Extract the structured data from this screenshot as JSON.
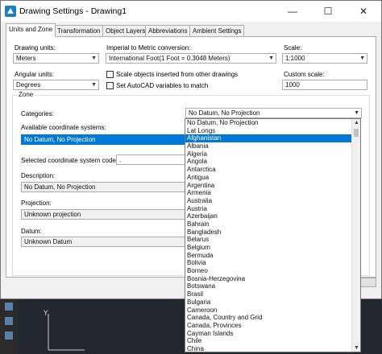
{
  "window": {
    "title": "Drawing Settings - Drawing1",
    "minimize": "—",
    "maximize": "☐",
    "close": "✕"
  },
  "tabs": [
    "Units and Zone",
    "Transformation",
    "Object Layers",
    "Abbreviations",
    "Ambient Settings"
  ],
  "units": {
    "drawing_units_label": "Drawing units:",
    "drawing_units_value": "Meters",
    "imperial_label": "Imperial to Metric conversion:",
    "imperial_value": "International Foot(1 Foot = 0.3048 Meters)",
    "scale_label": "Scale:",
    "scale_value": "1:1000",
    "angular_label": "Angular units:",
    "angular_value": "Degrees",
    "scale_objects_label": "Scale objects inserted from other drawings",
    "set_autocad_label": "Set AutoCAD variables to match",
    "custom_scale_label": "Custom scale:",
    "custom_scale_value": "1000"
  },
  "zone": {
    "title": "Zone",
    "categories_label": "Categories:",
    "categories_value": "No Datum, No Projection",
    "available_label": "Available coordinate systems:",
    "available_value": "No Datum, No Projection",
    "selected_code_label": "Selected coordinate system code:",
    "selected_code_value": ".",
    "description_label": "Description:",
    "description_value": "No Datum, No Projection",
    "projection_label": "Projection:",
    "projection_value": "Unknown projection",
    "datum_label": "Datum:",
    "datum_value": "Unknown Datum"
  },
  "dropdown": {
    "items": [
      "No Datum, No Projection",
      "Lat Longs",
      "Afghanistan",
      "Albania",
      "Algeria",
      "Angola",
      "Antarctica",
      "Antigua",
      "Argentina",
      "Armenia",
      "Australia",
      "Austria",
      "Azerbaijan",
      "Bahrain",
      "Bangladesh",
      "Belarus",
      "Belgium",
      "Bermuda",
      "Bolivia",
      "Borneo",
      "Bosnia-Herzegovina",
      "Botswana",
      "Brasil",
      "Bulgaria",
      "Cameroon",
      "Canada, Country and Grid",
      "Canada, Provinces",
      "Cayman Islands",
      "Chile",
      "China"
    ],
    "highlighted_index": 2
  },
  "colors": {
    "accent": "#0078d7"
  }
}
